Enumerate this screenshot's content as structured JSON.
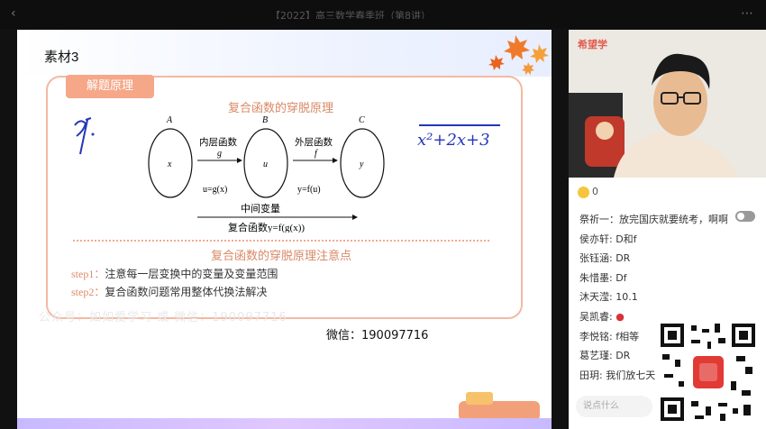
{
  "topbar": {
    "title": "【2022】高三数学春季班（第8讲）",
    "back_icon": "chevron-left-icon",
    "menu_icon": "more-icon"
  },
  "slide": {
    "header_label": "素材3",
    "tag": "解题原理",
    "title1": "复合函数的穿脱原理",
    "diagram": {
      "set_a": "A",
      "set_b": "B",
      "set_c": "C",
      "var_x": "x",
      "var_u": "u",
      "var_y": "y",
      "inner_label": "内层函数",
      "inner_f": "g",
      "inner_eq": "u=g(x)",
      "outer_label": "外层函数",
      "outer_f": "f",
      "outer_eq": "y=f(u)",
      "middle": "中间变量",
      "composite": "复合函数y=f(g(x))"
    },
    "title2": "复合函数的穿脱原理注意点",
    "step1_key": "step1：",
    "step1_text": "注意每一层变换中的变量及变量范围",
    "step2_key": "step2：",
    "step2_text": "复合函数问题常用整体代换法解决",
    "wechat": "微信：190097716",
    "watermark": "公众号：如如爱学习 或 微信：190097716",
    "hand_note1": "2f.",
    "hand_note2": "x²+2x+3"
  },
  "video": {
    "brand": "希望学"
  },
  "chat": {
    "likes": "0",
    "messages": [
      "祭祈一：放完国庆就要统考，啊啊",
      "侯亦轩: D和f",
      "张钰涵: DR",
      "朱惜墨: Df",
      "沐天滢: 10.1",
      "吴凯睿: ",
      "李悦铭: f相等",
      "葛艺瑾: DR",
      "田玥: 我们放七天"
    ],
    "input_placeholder": "说点什么"
  },
  "colors": {
    "accent": "#f5a788",
    "title": "#d98866",
    "brand": "#e25a4c"
  }
}
